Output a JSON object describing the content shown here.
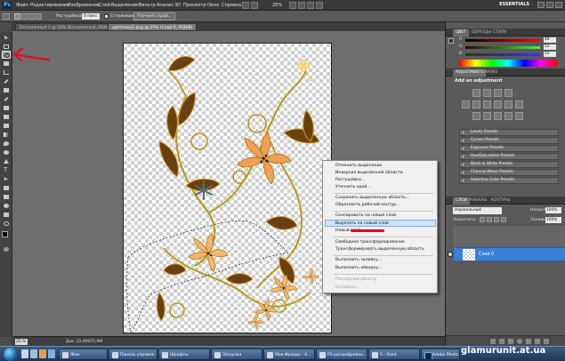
{
  "menubar": {
    "app_logo": "Ps",
    "items": [
      "Файл",
      "Редактирование",
      "Изображение",
      "Слой",
      "Выделение",
      "Фильтр",
      "Анализ",
      "3D",
      "Просмотр",
      "Окно",
      "Справка"
    ],
    "zoom_value": "25%",
    "workspace": "ESSENTIALS"
  },
  "options_bar": {
    "feather_label": "Растушёвка:",
    "feather_value": "0 пикс",
    "antialias_label": "Сглаживание",
    "refine_button": "Уточнить край..."
  },
  "document_tabs": [
    {
      "label": "Безымянный-1 @ 50% (Безымянный, RGB/8)",
      "active": false
    },
    {
      "label": "цветочки2.png @ 25% (Слой 0, RGB/8)",
      "active": true
    }
  ],
  "context_menu": {
    "items": [
      {
        "label": "Отменить выделение",
        "disabled": false,
        "highlighted": false
      },
      {
        "label": "Инверсия выделенной области",
        "disabled": false,
        "highlighted": false
      },
      {
        "label": "Растушёвка...",
        "disabled": false,
        "highlighted": false
      },
      {
        "label": "Уточнить край...",
        "disabled": false,
        "highlighted": false
      },
      {
        "label": "Сохранить выделенную область...",
        "disabled": false,
        "highlighted": false
      },
      {
        "label": "Образовать рабочий контур...",
        "disabled": false,
        "highlighted": false
      },
      {
        "label": "Скопировать на новый слой",
        "disabled": false,
        "highlighted": false
      },
      {
        "label": "Вырезать на новый слой",
        "disabled": false,
        "highlighted": true
      },
      {
        "label": "Новый слой...",
        "disabled": false,
        "highlighted": false
      },
      {
        "label": "Свободное трансформирование",
        "disabled": false,
        "highlighted": false
      },
      {
        "label": "Трансформировать выделенную область",
        "disabled": false,
        "highlighted": false
      },
      {
        "label": "Выполнить заливку...",
        "disabled": false,
        "highlighted": false
      },
      {
        "label": "Выполнить обводку...",
        "disabled": false,
        "highlighted": false
      },
      {
        "label": "Последний фильтр",
        "disabled": true,
        "highlighted": false
      },
      {
        "label": "Ослабить...",
        "disabled": true,
        "highlighted": false
      }
    ]
  },
  "status_bar": {
    "zoom": "25 %",
    "doc_info": "Док: 22,6М/25,9М"
  },
  "color_panel": {
    "tabs": [
      "ЦВЕТ",
      "ОБРАЗЦЫ",
      "СТИЛИ"
    ],
    "channels": [
      {
        "label": "R",
        "value": "49"
      },
      {
        "label": "G",
        "value": "52"
      },
      {
        "label": "B",
        "value": "52"
      }
    ]
  },
  "adjustments_panel": {
    "tabs": [
      "ADJUSTMENTS",
      "MASKS"
    ],
    "title": "Add an adjustment",
    "presets": [
      "Levels Presets",
      "Curves Presets",
      "Exposure Presets",
      "Hue/Saturation Presets",
      "Black & White Presets",
      "Channel Mixer Presets",
      "Selective Color Presets"
    ]
  },
  "layers_panel": {
    "tabs": [
      "СЛОИ",
      "КАНАЛЫ",
      "КОНТУРЫ"
    ],
    "blend_mode": "Нормальный",
    "opacity_label": "Непрозр.:",
    "opacity_value": "100%",
    "lock_label": "Закрепить:",
    "fill_label": "Заливка:",
    "fill_value": "100%",
    "layers": [
      {
        "name": "Слой 0",
        "selected": true
      }
    ]
  },
  "taskbar": {
    "items": [
      "Жин",
      "Панель управле...",
      "Шрифты",
      "Загрузка",
      "Мои Фракро - 6...",
      "РЗ расшифрован...",
      "5 - Paint",
      "Adobe Photo..."
    ]
  },
  "watermark": "glamurunit.at.ua",
  "colors": {
    "accent_selection": "#3a7fd8",
    "annotation_red": "#d01020",
    "flower_orange": "#f0a050",
    "leaf_brown": "#6b3f10"
  }
}
